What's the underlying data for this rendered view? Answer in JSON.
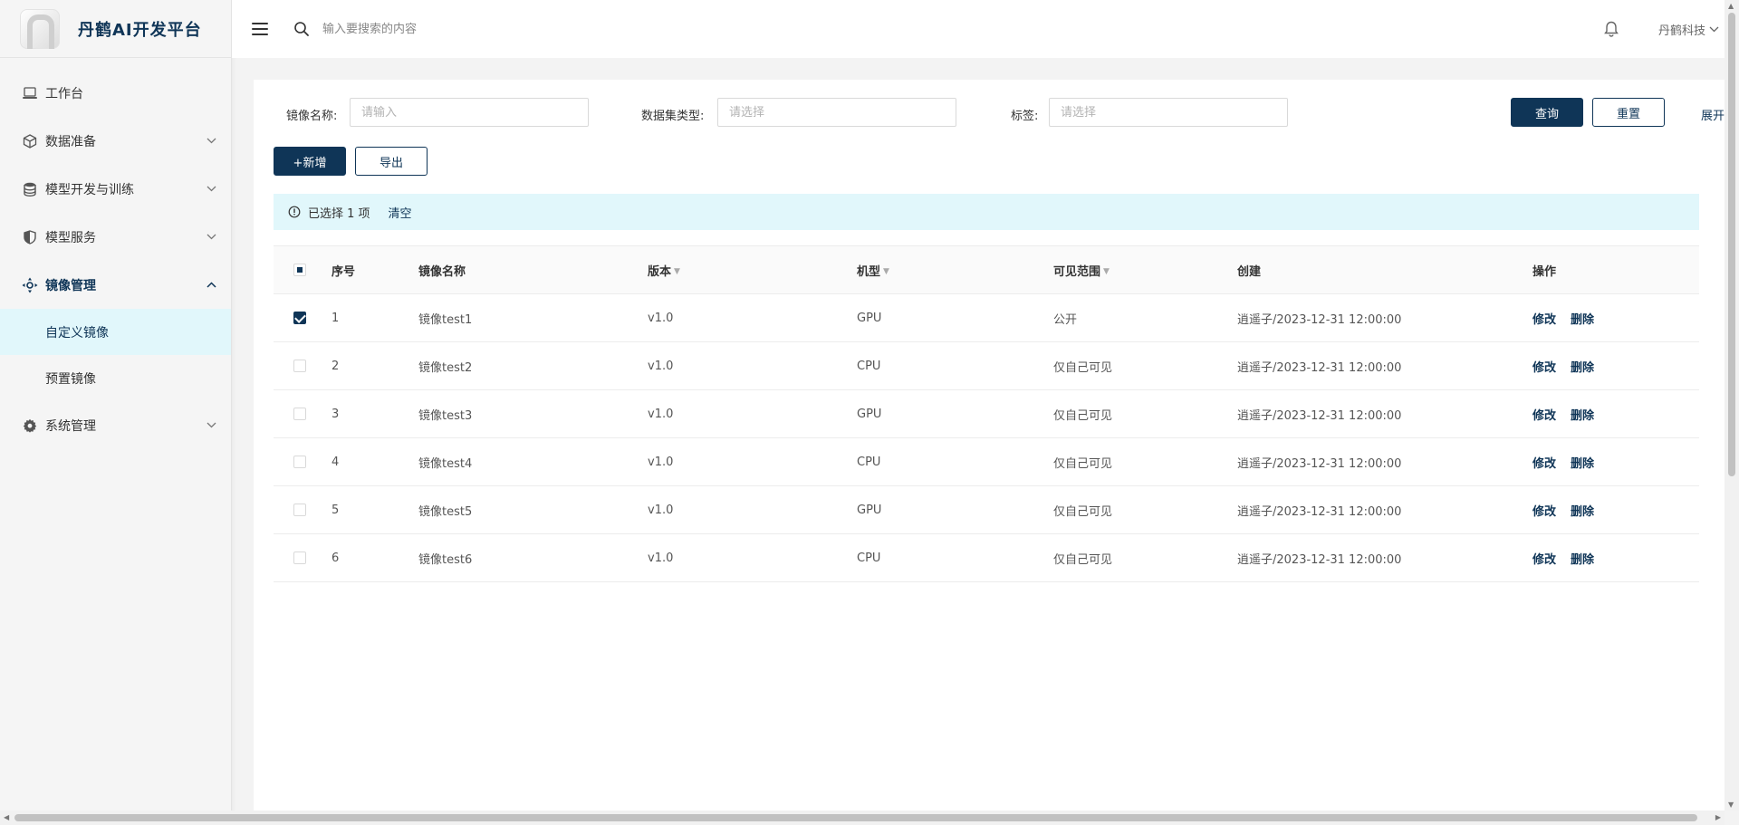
{
  "app": {
    "title": "丹鹤AI开发平台"
  },
  "header": {
    "search_placeholder": "输入要搜索的内容",
    "user_name": "丹鹤科技"
  },
  "sidebar": {
    "items": [
      {
        "label": "工作台",
        "icon": "laptop-icon"
      },
      {
        "label": "数据准备",
        "icon": "cube-icon"
      },
      {
        "label": "模型开发与训练",
        "icon": "database-icon"
      },
      {
        "label": "模型服务",
        "icon": "shield-icon"
      },
      {
        "label": "镜像管理",
        "icon": "move-icon"
      },
      {
        "label": "系统管理",
        "icon": "gear-icon"
      }
    ],
    "sub_items": [
      {
        "label": "自定义镜像"
      },
      {
        "label": "预置镜像"
      }
    ]
  },
  "filters": {
    "name_label": "镜像名称:",
    "name_placeholder": "请输入",
    "dataset_label": "数据集类型:",
    "dataset_placeholder": "请选择",
    "tag_label": "标签:",
    "tag_placeholder": "请选择",
    "query_label": "查询",
    "reset_label": "重置",
    "expand_label": "展开"
  },
  "actions": {
    "add_label": "+新增",
    "export_label": "导出"
  },
  "alert": {
    "selected_text": "已选择 1 项",
    "clear_label": "清空"
  },
  "table": {
    "columns": [
      "序号",
      "镜像名称",
      "版本",
      "机型",
      "可见范围",
      "创建",
      "操作"
    ],
    "edit_label": "修改",
    "delete_label": "删除",
    "rows": [
      {
        "index": "1",
        "name": "镜像test1",
        "version": "v1.0",
        "machine": "GPU",
        "visibility": "公开",
        "created": "逍遥子/2023-12-31 12:00:00",
        "checked": true
      },
      {
        "index": "2",
        "name": "镜像test2",
        "version": "v1.0",
        "machine": "CPU",
        "visibility": "仅自己可见",
        "created": "逍遥子/2023-12-31 12:00:00",
        "checked": false
      },
      {
        "index": "3",
        "name": "镜像test3",
        "version": "v1.0",
        "machine": "GPU",
        "visibility": "仅自己可见",
        "created": "逍遥子/2023-12-31 12:00:00",
        "checked": false
      },
      {
        "index": "4",
        "name": "镜像test4",
        "version": "v1.0",
        "machine": "CPU",
        "visibility": "仅自己可见",
        "created": "逍遥子/2023-12-31 12:00:00",
        "checked": false
      },
      {
        "index": "5",
        "name": "镜像test5",
        "version": "v1.0",
        "machine": "GPU",
        "visibility": "仅自己可见",
        "created": "逍遥子/2023-12-31 12:00:00",
        "checked": false
      },
      {
        "index": "6",
        "name": "镜像test6",
        "version": "v1.0",
        "machine": "CPU",
        "visibility": "仅自己可见",
        "created": "逍遥子/2023-12-31 12:00:00",
        "checked": false
      }
    ]
  },
  "colors": {
    "primary": "#0f3557",
    "highlight": "#e1f7fb"
  }
}
